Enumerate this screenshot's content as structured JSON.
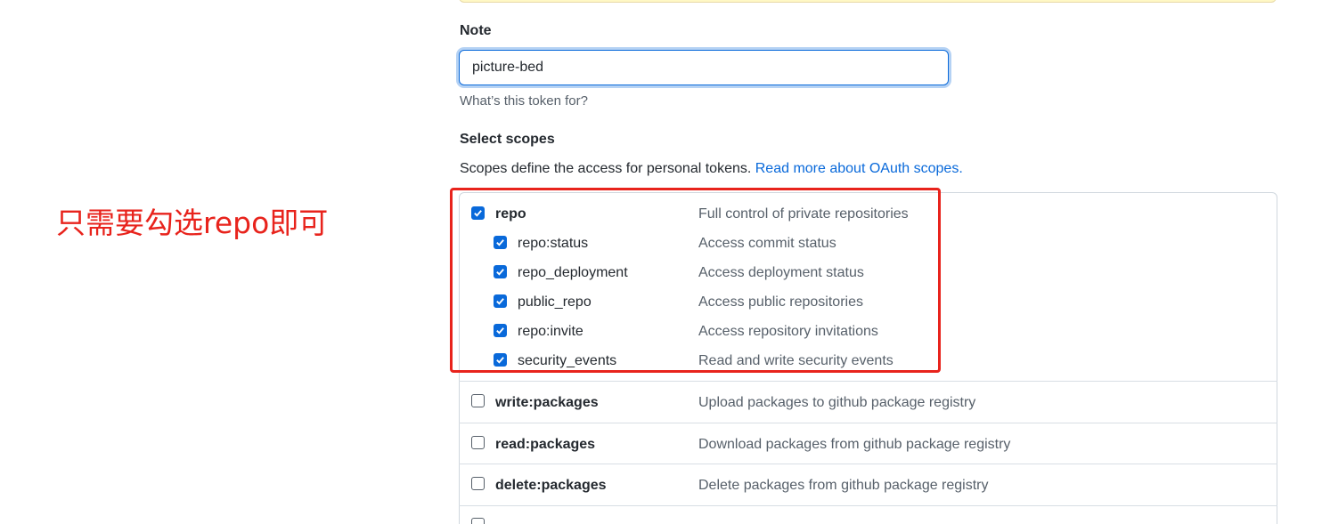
{
  "note": {
    "label": "Note",
    "value": "picture-bed",
    "help": "What’s this token for?"
  },
  "scopes": {
    "title": "Select scopes",
    "description": "Scopes define the access for personal tokens. ",
    "link_text": "Read more about OAuth scopes.",
    "items": [
      {
        "name": "repo",
        "desc": "Full control of private repositories",
        "checked": true
      },
      {
        "name": "repo:status",
        "desc": "Access commit status",
        "checked": true
      },
      {
        "name": "repo_deployment",
        "desc": "Access deployment status",
        "checked": true
      },
      {
        "name": "public_repo",
        "desc": "Access public repositories",
        "checked": true
      },
      {
        "name": "repo:invite",
        "desc": "Access repository invitations",
        "checked": true
      },
      {
        "name": "security_events",
        "desc": "Read and write security events",
        "checked": true
      },
      {
        "name": "write:packages",
        "desc": "Upload packages to github package registry",
        "checked": false
      },
      {
        "name": "read:packages",
        "desc": "Download packages from github package registry",
        "checked": false
      },
      {
        "name": "delete:packages",
        "desc": "Delete packages from github package registry",
        "checked": false
      }
    ]
  },
  "annotation": {
    "text": "只需要勾选repo即可",
    "color": "#e8231c"
  },
  "colors": {
    "accent": "#0969da",
    "muted": "#57606a",
    "border": "#d0d7de"
  }
}
